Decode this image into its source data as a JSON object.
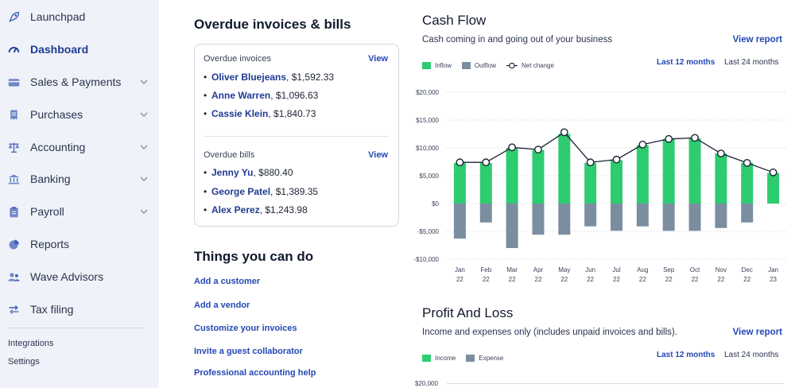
{
  "sidebar": {
    "items": [
      {
        "label": "Launchpad",
        "icon": "rocket-icon",
        "active": false,
        "expandable": false
      },
      {
        "label": "Dashboard",
        "icon": "gauge-icon",
        "active": true,
        "expandable": false
      },
      {
        "label": "Sales & Payments",
        "icon": "card-icon",
        "active": false,
        "expandable": true
      },
      {
        "label": "Purchases",
        "icon": "receipt-icon",
        "active": false,
        "expandable": true
      },
      {
        "label": "Accounting",
        "icon": "scale-icon",
        "active": false,
        "expandable": true
      },
      {
        "label": "Banking",
        "icon": "bank-icon",
        "active": false,
        "expandable": true
      },
      {
        "label": "Payroll",
        "icon": "clipboard-icon",
        "active": false,
        "expandable": true
      },
      {
        "label": "Reports",
        "icon": "pie-chart-icon",
        "active": false,
        "expandable": false
      },
      {
        "label": "Wave Advisors",
        "icon": "people-icon",
        "active": false,
        "expandable": false
      },
      {
        "label": "Tax filing",
        "icon": "arrows-icon",
        "active": false,
        "expandable": false
      }
    ],
    "footer_links": [
      "Integrations",
      "Settings"
    ]
  },
  "overdue": {
    "title": "Overdue invoices & bills",
    "invoices_label": "Overdue invoices",
    "bills_label": "Overdue bills",
    "view_label": "View",
    "invoices": [
      {
        "name": "Oliver Bluejeans",
        "amount": ", $1,592.33"
      },
      {
        "name": "Anne Warren",
        "amount": ", $1,096.63"
      },
      {
        "name": "Cassie Klein",
        "amount": ", $1,840.73"
      }
    ],
    "bills": [
      {
        "name": "Jenny Yu",
        "amount": ", $880.40"
      },
      {
        "name": "George Patel",
        "amount": ", $1,389.35"
      },
      {
        "name": "Alex Perez",
        "amount": ", $1,243.98"
      }
    ]
  },
  "todo": {
    "title": "Things you can do",
    "links": [
      "Add a customer",
      "Add a vendor",
      "Customize your invoices",
      "Invite a guest collaborator",
      "Professional accounting help"
    ]
  },
  "cashflow": {
    "title": "Cash Flow",
    "subtitle": "Cash coming in and going out of your business",
    "view_report": "View report",
    "legend": {
      "inflow": "Inflow",
      "outflow": "Outflow",
      "net": "Net change"
    },
    "ranges": [
      "Last 12 months",
      "Last 24 months"
    ],
    "selected_range": "Last 12 months"
  },
  "profitloss": {
    "title": "Profit And Loss",
    "subtitle": "Income and expenses only (includes unpaid invoices and bills).",
    "view_report": "View report",
    "legend": {
      "income": "Income",
      "expense": "Expense"
    },
    "ranges": [
      "Last 12 months",
      "Last 24 months"
    ],
    "first_tick": "$20,000"
  },
  "colors": {
    "inflow": "#2ecc71",
    "outflow": "#7b8ea0",
    "accent": "#2448b5",
    "sidebar_bg": "#eff2f8"
  },
  "chart_data": {
    "type": "bar",
    "categories": [
      "Jan 22",
      "Feb 22",
      "Mar 22",
      "Apr 22",
      "May 22",
      "Jun 22",
      "Jul 22",
      "Aug 22",
      "Sep 22",
      "Oct 22",
      "Nov 22",
      "Dec 22",
      "Jan 23"
    ],
    "x_labels": [
      [
        "Jan",
        "22"
      ],
      [
        "Feb",
        "22"
      ],
      [
        "Mar",
        "22"
      ],
      [
        "Apr",
        "22"
      ],
      [
        "May",
        "22"
      ],
      [
        "Jun",
        "22"
      ],
      [
        "Jul",
        "22"
      ],
      [
        "Aug",
        "22"
      ],
      [
        "Sep",
        "22"
      ],
      [
        "Oct",
        "22"
      ],
      [
        "Nov",
        "22"
      ],
      [
        "Dec",
        "22"
      ],
      [
        "Jan",
        "23"
      ]
    ],
    "series": [
      {
        "name": "Inflow",
        "type": "bar",
        "values": [
          7300,
          7300,
          10000,
          9600,
          12500,
          7300,
          7800,
          10500,
          11600,
          11700,
          9000,
          7300,
          5500
        ]
      },
      {
        "name": "Outflow",
        "type": "bar",
        "values": [
          -6300,
          -3400,
          -8000,
          -5600,
          -5600,
          -4100,
          -4900,
          -4100,
          -4900,
          -4900,
          -4400,
          -3400,
          0
        ]
      },
      {
        "name": "Net change",
        "type": "line",
        "values": [
          7400,
          7400,
          10100,
          9700,
          12800,
          7400,
          7900,
          10600,
          11600,
          11800,
          9000,
          7300,
          5600
        ]
      }
    ],
    "y_ticks": [
      "$20,000",
      "$15,000",
      "$10,000",
      "$5,000",
      "$0",
      "-$5,000",
      "-$10,000"
    ],
    "ylim": [
      -10000,
      20000
    ],
    "grid": true,
    "legend": "top-left"
  }
}
